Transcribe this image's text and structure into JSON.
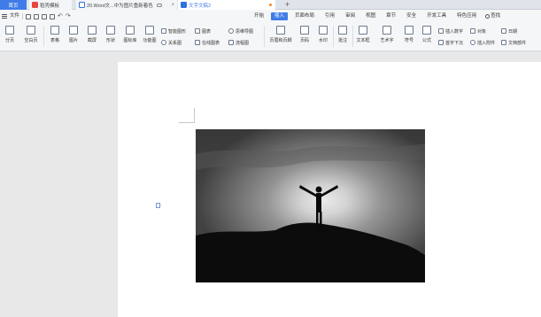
{
  "tabs": {
    "home": "首页",
    "t1": "稻壳模板",
    "t2": "20.Word文...中为图片重新着色",
    "t3": "文字文稿2",
    "close": "×",
    "new_tab": "+"
  },
  "menubar": {
    "file": "文件",
    "undo": "↶",
    "redo": "↷",
    "menus": [
      "开始",
      "插入",
      "页面布局",
      "引用",
      "审阅",
      "视图",
      "章节",
      "安全",
      "开发工具",
      "特色应用"
    ],
    "active_menu": "插入",
    "search": "查找"
  },
  "ribbon": {
    "paging": "分页",
    "blank_page": "空白页",
    "table": "表格",
    "picture": "图片",
    "screenshot": "截屏",
    "shapes": "形状",
    "icon_lib": "图标库",
    "func_chart": "功能图",
    "smart_graphic": "智能图形",
    "chart": "图表",
    "mind_map": "思维导图",
    "relation_map": "关系图",
    "online_chart": "在线图表",
    "flowchart": "流程图",
    "header_footer": "页眉和页脚",
    "page_number": "页码",
    "watermark": "水印",
    "comment": "批注",
    "textbox": "文本框",
    "wordart": "艺术字",
    "symbol": "符号",
    "formula": "公式",
    "insert_number": "插入数字",
    "object": "对象",
    "date": "日期",
    "drop_cap": "首字下沉",
    "attachment": "插入附件",
    "doc_parts": "文档部件"
  },
  "colors": {
    "accent": "#3f7ce8",
    "tab_active_text": "#3f7ce8",
    "doc_bg": "#ffffff",
    "canvas_bg": "#e8e8e8"
  }
}
